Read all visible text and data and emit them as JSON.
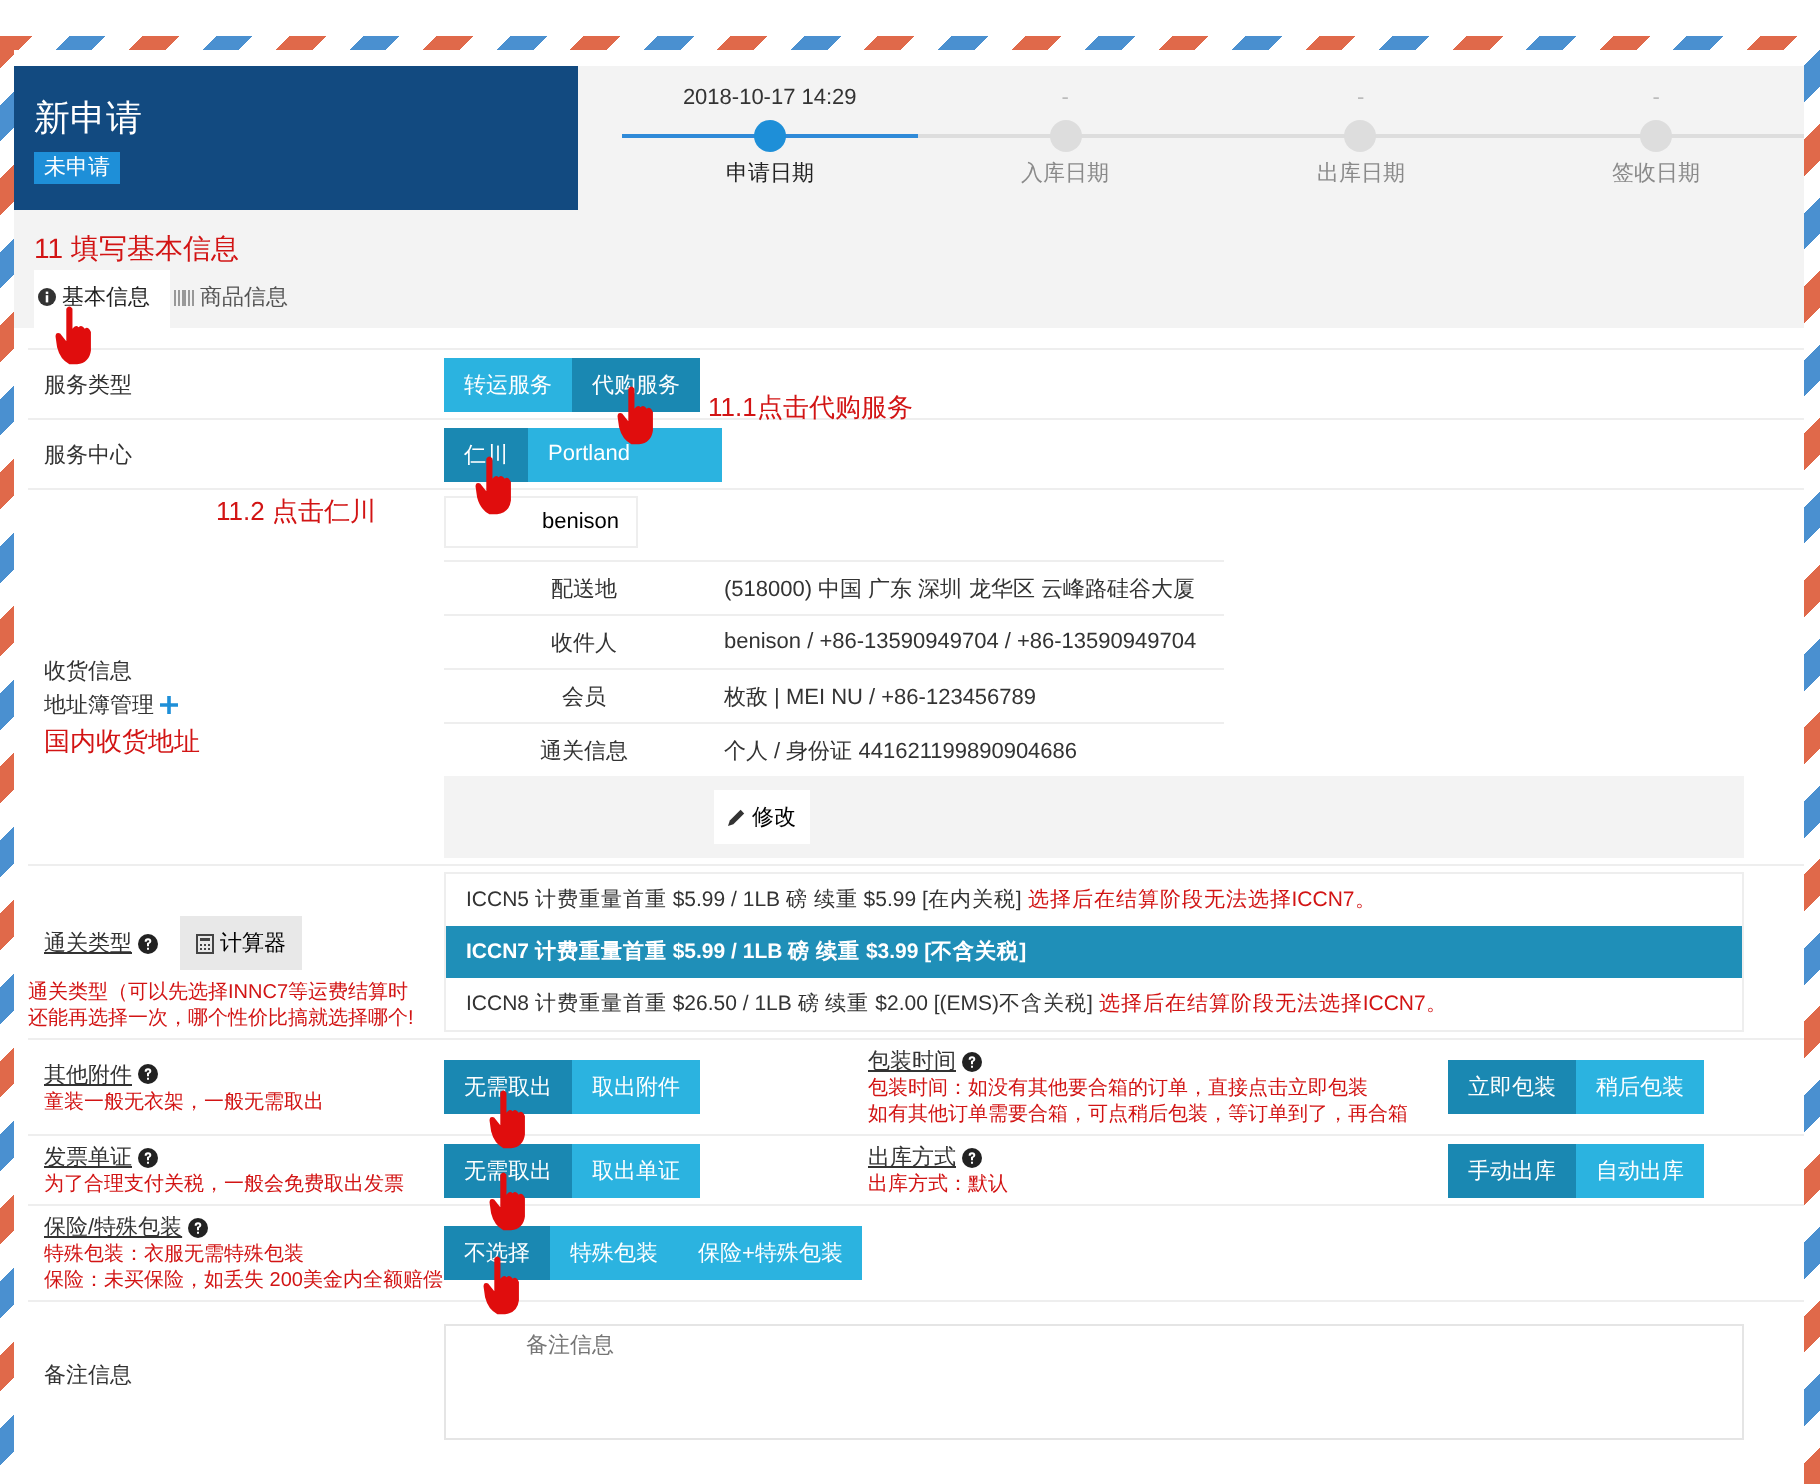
{
  "header": {
    "title": "新申请",
    "status": "未申请"
  },
  "progress": [
    {
      "label": "申请日期",
      "time": "2018-10-17 14:29",
      "done": true
    },
    {
      "label": "入库日期",
      "time": "-",
      "done": false
    },
    {
      "label": "出库日期",
      "time": "-",
      "done": false
    },
    {
      "label": "签收日期",
      "time": "-",
      "done": false
    }
  ],
  "step_note": "11 填写基本信息",
  "tabs": [
    {
      "label": "基本信息",
      "selected": true,
      "pointed": true
    },
    {
      "label": "商品信息",
      "selected": false,
      "pointed": false
    }
  ],
  "rows": [
    {
      "kind": "choice",
      "label": "服务类型",
      "note": "11.1点击代购服务",
      "options": [
        {
          "label": "转运服务",
          "selected": false,
          "pointed": false
        },
        {
          "label": "代购服务",
          "selected": true,
          "pointed": true
        }
      ]
    },
    {
      "kind": "choice",
      "label": "服务中心",
      "note": "11.2 点击仁川",
      "options": [
        {
          "label": "仁川",
          "selected": true,
          "pointed": true
        },
        {
          "label": "Portland",
          "selected": false,
          "pointed": false
        },
        {
          "selected": false,
          "pointed": false
        }
      ]
    },
    {
      "kind": "address",
      "label": "收货信息",
      "link": "地址簿管理",
      "note": "国内收货地址",
      "contact": "benison",
      "fields": [
        {
          "label": "配送地",
          "value": "(518000) 中国 广东 深圳 龙华区 云峰路硅谷大厦"
        },
        {
          "label": "收件人",
          "value": "benison  / +86-13590949704  / +86-13590949704"
        },
        {
          "label": "会员",
          "value": "枚敌  | MEI NU  / +86-123456789"
        },
        {
          "label": "通关信息",
          "value": "个人  / 身份证 441621199890904686"
        }
      ],
      "edit": "修改"
    },
    {
      "kind": "customs",
      "label": "通关类型",
      "help": true,
      "tool": "计算器",
      "notes": [
        "通关类型（可以先选择INNC7等运费结算时",
        "还能再选择一次，哪个性价比搞就选择哪个!"
      ],
      "options": [
        {
          "label": "ICCN5 计费重量首重 $5.99 / 1LB 磅 续重 $5.99 [在内关税]",
          "warning": "选择后在结算阶段无法选择ICCN7。",
          "selected": false
        },
        {
          "label": "ICCN7 计费重量首重 $5.99 / 1LB 磅 续重 $3.99 [不含关税]",
          "selected": true
        },
        {
          "label": "ICCN8 计费重量首重 $26.50 / 1LB 磅 续重 $2.00 [(EMS)不含关税]",
          "warning": "选择后在结算阶段无法选择ICCN7。",
          "selected": false
        }
      ]
    },
    {
      "kind": "pair",
      "fields": [
        {
          "label": "其他附件",
          "help": true,
          "notes": [
            "童装一般无衣架，一般无需取出"
          ],
          "options": [
            {
              "label": "无需取出",
              "selected": true,
              "pointed": true
            },
            {
              "label": "取出附件",
              "selected": false,
              "pointed": false
            }
          ]
        },
        {
          "label": "包装时间",
          "help": true,
          "notes": [
            "包装时间：如没有其他要合箱的订单，直接点击立即包装",
            "如有其他订单需要合箱，可点稍后包装，等订单到了，再合箱"
          ],
          "options": [
            {
              "label": "立即包装",
              "selected": true,
              "pointed": false
            },
            {
              "label": "稍后包装",
              "selected": false,
              "pointed": false
            }
          ]
        }
      ]
    },
    {
      "kind": "pair",
      "fields": [
        {
          "label": "发票单证",
          "help": true,
          "notes": [
            "为了合理支付关税，一般会免费取出发票"
          ],
          "options": [
            {
              "label": "无需取出",
              "selected": true,
              "pointed": true
            },
            {
              "label": "取出单证",
              "selected": false,
              "pointed": false
            }
          ]
        },
        {
          "label": "出库方式",
          "help": true,
          "notes": [
            "出库方式：默认"
          ],
          "options": [
            {
              "label": "手动出库",
              "selected": true,
              "pointed": false
            },
            {
              "label": "自动出库",
              "selected": false,
              "pointed": false
            }
          ]
        }
      ]
    },
    {
      "kind": "choice",
      "label": "保险/特殊包装",
      "help": true,
      "notes": [
        "特殊包装：衣服无需特殊包装",
        "保险：未买保险，如丢失 200美金内全额赔偿"
      ],
      "options": [
        {
          "label": "不选择",
          "selected": true,
          "pointed": true
        },
        {
          "label": "特殊包装",
          "selected": false,
          "pointed": false
        },
        {
          "label": "保险+特殊包装",
          "selected": false,
          "pointed": false
        }
      ]
    },
    {
      "kind": "remarks",
      "label": "备注信息",
      "placeholder": "备注信息"
    }
  ]
}
